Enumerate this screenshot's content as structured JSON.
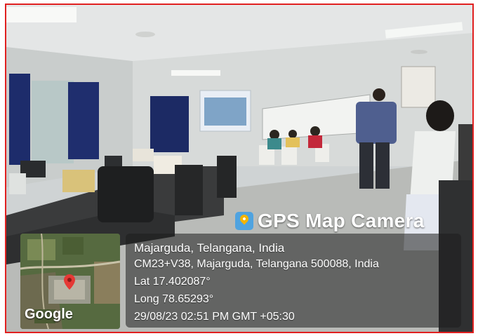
{
  "overlay": {
    "title": "GPS Map Camera",
    "place": "Majarguda, Telangana, India",
    "address": "CM23+V38, Majarguda, Telangana 500088, India",
    "lat": "Lat 17.402087°",
    "long": "Long 78.65293°",
    "datetime": "29/08/23 02:51 PM GMT +05:30",
    "map_attribution": "Google"
  },
  "colors": {
    "frame_border": "#e02020",
    "badge": "#4fa3e0",
    "map_pin": "#e53935"
  }
}
